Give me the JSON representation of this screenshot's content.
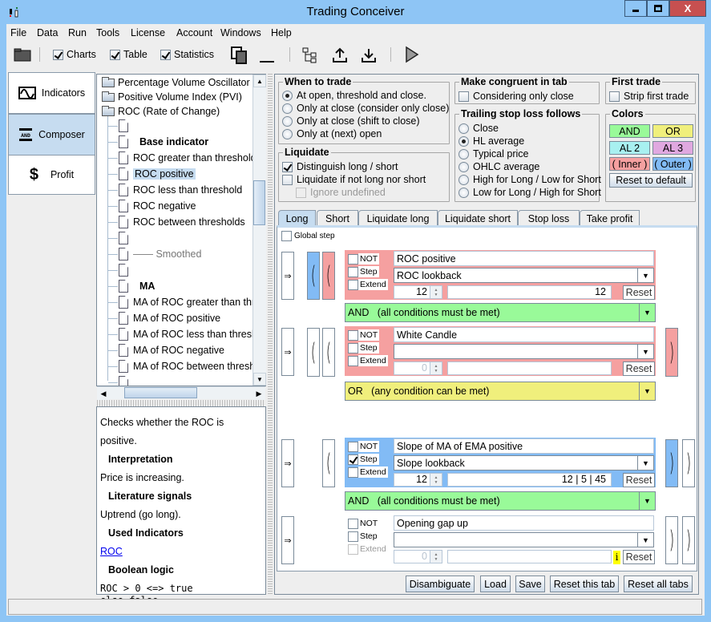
{
  "window": {
    "title": "Trading Conceiver",
    "minimize": "–",
    "maximize": "□",
    "close": "X"
  },
  "menu": [
    "File",
    "Data",
    "Run",
    "Tools",
    "License",
    "Account",
    "Windows",
    "Help"
  ],
  "toolbar": {
    "checks": [
      {
        "label": "Charts",
        "checked": true
      },
      {
        "label": "Table",
        "checked": true
      },
      {
        "label": "Statistics",
        "checked": true
      }
    ]
  },
  "nav": [
    {
      "label": "Indicators",
      "icon": "wave-icon"
    },
    {
      "label": "Composer",
      "icon": "and-gate-icon",
      "active": true
    },
    {
      "label": "Profit",
      "icon": "dollar-icon"
    }
  ],
  "tree": {
    "folders": [
      "Percentage Volume Oscillator (",
      "Positive Volume Index (PVI)",
      "ROC (Rate of Change)"
    ],
    "items": [
      "",
      "Base indicator",
      "ROC greater than threshold",
      "ROC positive",
      "ROC less than threshold",
      "ROC negative",
      "ROC between thresholds",
      "",
      "—— Smoothed",
      "",
      "MA",
      "MA of ROC greater than threshold",
      "MA of ROC positive",
      "MA of ROC less than threshold",
      "MA of ROC negative",
      "MA of ROC between thresholds",
      ""
    ],
    "selected": "ROC positive"
  },
  "description": {
    "summary": "Checks whether the ROC is positive.",
    "interpretation_title": "Interpretation",
    "interpretation": "Price is increasing.",
    "literature_title": "Literature signals",
    "literature": "Uptrend (go long).",
    "used_title": "Used Indicators",
    "used_link": "ROC",
    "logic_title": "Boolean logic",
    "logic_line1": "ROC > 0 <=> true",
    "logic_line2": "else false"
  },
  "when_to_trade": {
    "title": "When to trade",
    "options": [
      "At open, threshold and close.",
      "Only at close (consider only close)",
      "Only at close (shift to close)",
      "Only at (next) open"
    ],
    "selected": 0
  },
  "liquidate": {
    "title": "Liquidate",
    "distinguish": "Distinguish long / short",
    "distinguish_checked": true,
    "if_not": "Liquidate if not long nor short",
    "ignore": "Ignore undefined"
  },
  "congruent": {
    "title": "Make congruent in tab",
    "label": "Considering only close"
  },
  "first_trade": {
    "title": "First trade",
    "label": "Strip first trade"
  },
  "trailing": {
    "title": "Trailing stop loss follows",
    "options": [
      "Close",
      "HL average",
      "Typical price",
      "OHLC average",
      "High for Long / Low for Short",
      "Low for Long / High for Short"
    ],
    "selected": 1
  },
  "colors": {
    "title": "Colors",
    "and": {
      "label": "AND",
      "color": "#99fa99"
    },
    "or": {
      "label": "OR",
      "color": "#f0ef7c"
    },
    "al2": {
      "label": "AL 2",
      "color": "#a8f0f0"
    },
    "al3": {
      "label": "AL 3",
      "color": "#e0a8e0"
    },
    "inner": {
      "label": "( Inner )",
      "color": "#f5a0a0"
    },
    "outer": {
      "label": "( Outer )",
      "color": "#82bbf5"
    },
    "reset": "Reset to default"
  },
  "tabs": [
    "Long",
    "Short",
    "Liquidate long",
    "Liquidate short",
    "Stop loss",
    "Take profit"
  ],
  "global_step": "Global step",
  "arrow": "⇒",
  "open_paren": "(",
  "close_paren": ")",
  "conditions": [
    {
      "not": "NOT",
      "step": "Step",
      "extend": "Extend",
      "name": "ROC positive",
      "param": "ROC lookback",
      "spin": "12",
      "value": "12",
      "reset": "Reset"
    },
    {
      "not": "NOT",
      "step": "Step",
      "extend": "Extend",
      "name": "White Candle",
      "param": "",
      "spin": "0",
      "value": "",
      "reset": "Reset"
    },
    {
      "not": "NOT",
      "step": "Step",
      "extend": "Extend",
      "name": "Slope of MA of EMA positive",
      "param": "Slope lookback",
      "spin": "12",
      "value": "12  |  5  |  45",
      "reset": "Reset",
      "step_checked": true
    },
    {
      "not": "NOT",
      "step": "Step",
      "extend": "Extend",
      "name": "Opening gap up",
      "param": "",
      "spin": "0",
      "value": "",
      "reset": "Reset",
      "info": "i"
    }
  ],
  "logic_ops": [
    {
      "label": "AND   (all conditions must be met)"
    },
    {
      "label": "OR   (any condition can be met)"
    },
    {
      "label": "AND   (all conditions must be met)"
    }
  ],
  "buttons": [
    "Disambiguate",
    "Load",
    "Save",
    "Reset this tab",
    "Reset all tabs"
  ]
}
